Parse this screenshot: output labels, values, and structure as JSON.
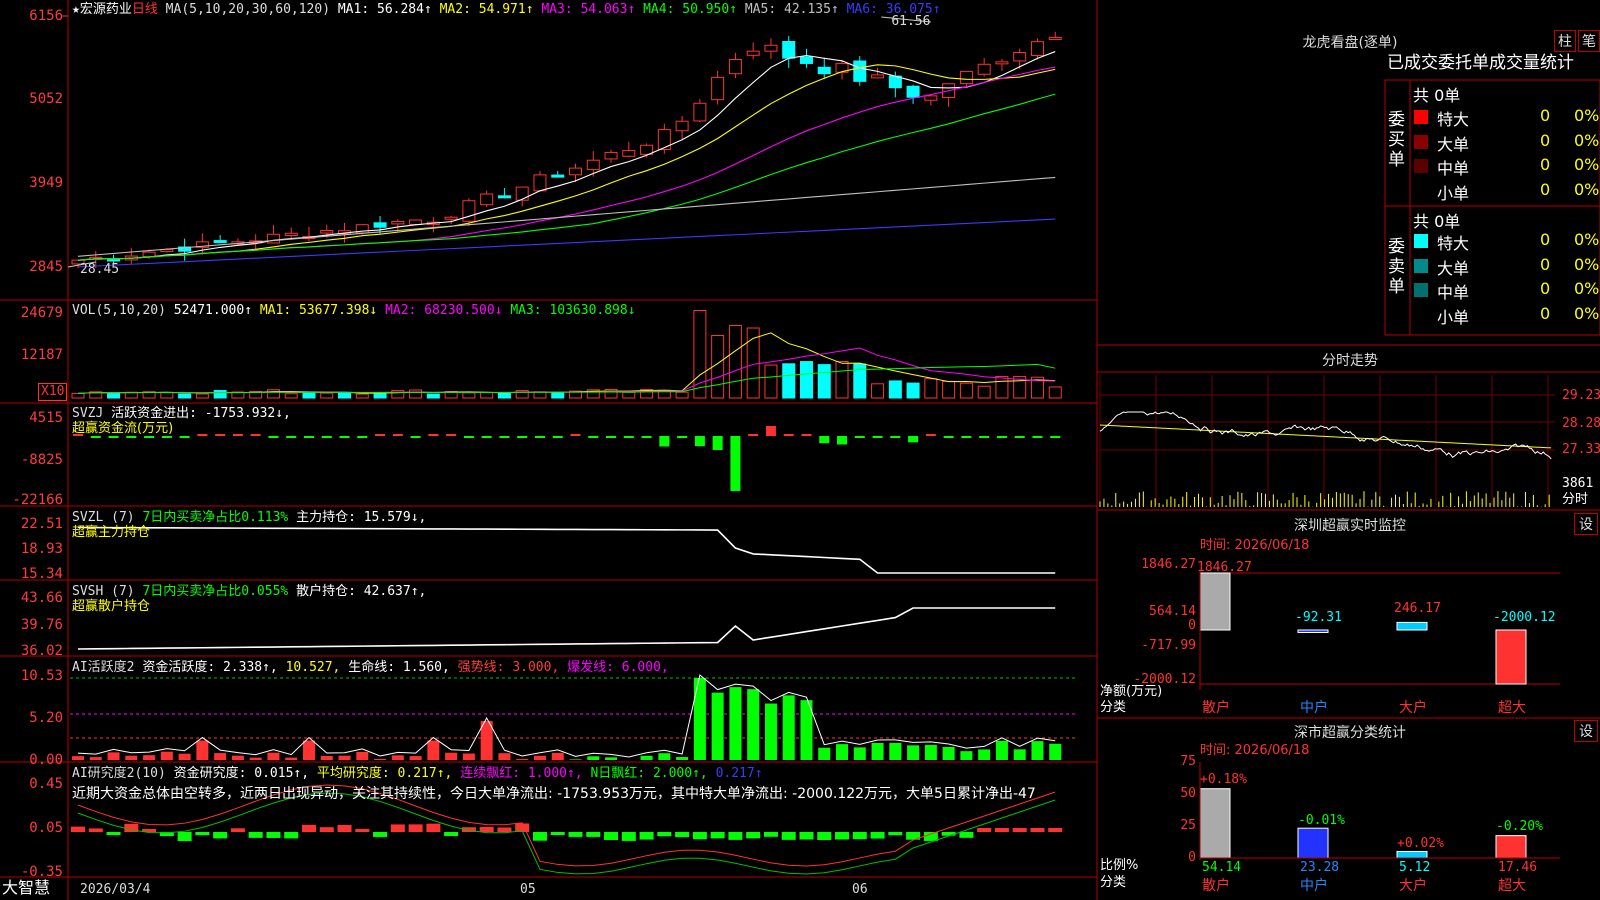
{
  "stock": {
    "name": "★宏源药业",
    "period": "日线"
  },
  "ma_line": {
    "label": "MA(5,10,20,30,60,120)",
    "items": [
      {
        "text": "MA1: 56.284↑",
        "color": "#ffffff"
      },
      {
        "text": "MA2: 54.971↑",
        "color": "#ffff00"
      },
      {
        "text": "MA3: 54.063↑",
        "color": "#ff00ff"
      },
      {
        "text": "MA4: 50.950↑",
        "color": "#00ff00"
      },
      {
        "text": "MA5: 42.135↑",
        "color": "#c0c0c0"
      },
      {
        "text": "MA6: 36.075↑",
        "color": "#3a3aff"
      }
    ]
  },
  "price_axis": [
    "6156",
    "5052",
    "3949",
    "2845"
  ],
  "price_annotations": {
    "high": "61.56",
    "low": "28.45"
  },
  "vol": {
    "label": "VOL(5,10,20)",
    "value": "52471.000↑",
    "items": [
      {
        "text": "MA1: 53677.398↓",
        "color": "#ffff00"
      },
      {
        "text": "MA2: 68230.500↓",
        "color": "#ff00ff"
      },
      {
        "text": "MA3: 103630.898↓",
        "color": "#00ff00"
      }
    ],
    "axis": [
      "24679",
      "12187"
    ],
    "unit": "X10"
  },
  "svzj": {
    "label": "SVZJ",
    "title": "活跃资金进出: -1753.932↓,",
    "subtitle": "超赢资金流(万元)",
    "axis": [
      "4515",
      "-8825",
      "-22166"
    ]
  },
  "svzl": {
    "label": "SVZL (7)",
    "title": "7日内买卖净占比0.113%",
    "value": "主力持仓: 15.579↓,",
    "subtitle": "超赢主力持仓",
    "axis": [
      "22.51",
      "18.93",
      "15.34"
    ]
  },
  "svsh": {
    "label": "SVSH (7)",
    "title": "7日内买卖净占比0.055%",
    "value": "散户持仓: 42.637↑,",
    "subtitle": "超赢散户持仓",
    "axis": [
      "43.66",
      "39.76",
      "36.02"
    ]
  },
  "ai_active": {
    "label": "AI活跃度2",
    "items": [
      {
        "text": "资金活跃度: 2.338↑,",
        "color": "#ffffff"
      },
      {
        "text": "10.527,",
        "color": "#ffff00"
      },
      {
        "text": "生命线: 1.560,",
        "color": "#ffffff"
      },
      {
        "text": "强势线: 3.000,",
        "color": "#ff3c3c"
      },
      {
        "text": "爆发线: 6.000,",
        "color": "#ff00ff"
      }
    ],
    "axis": [
      "10.53",
      "5.20",
      "0.00"
    ]
  },
  "ai_research": {
    "label": "AI研究度2(10)",
    "items": [
      {
        "text": "资金研究度: 0.015↑,",
        "color": "#ffffff"
      },
      {
        "text": "平均研究度: 0.217↑,",
        "color": "#ffff00"
      },
      {
        "text": "连续飘红: 1.000↑,",
        "color": "#ff00ff"
      },
      {
        "text": "N日飘红: 2.000↑,",
        "color": "#00ff00"
      },
      {
        "text": "0.217↑",
        "color": "#3a3aff"
      }
    ],
    "summary": "近期大资金总体由空转多，近两日出现异动，关注其持续性，今日大单净流出: -1753.953万元，其中特大单净流出: -2000.122万元，大单5日累计净出-47",
    "axis": [
      "0.45",
      "0.05",
      "-0.35"
    ]
  },
  "footer": {
    "brand": "大智慧",
    "date_start": "2026/03/4",
    "m05": "05",
    "m06": "06"
  },
  "dragon": {
    "title": "龙虎看盘(逐单)",
    "btn_bar": "柱",
    "btn_detail": "笔",
    "tabs": [
      "已成交",
      "委托单",
      "成交量统计"
    ],
    "buy_label": "委买单",
    "sell_label": "委卖单",
    "buy_total": "共 0单",
    "sell_total": "共 0单",
    "buy_rows": [
      {
        "name": "特大",
        "count": "0",
        "pct": "0%",
        "color": "#ff0000"
      },
      {
        "name": "大单",
        "count": "0",
        "pct": "0%",
        "color": "#8a0000"
      },
      {
        "name": "中单",
        "count": "0",
        "pct": "0%",
        "color": "#5a0000"
      },
      {
        "name": "小单",
        "count": "0",
        "pct": "0%",
        "color": ""
      }
    ],
    "sell_rows": [
      {
        "name": "特大",
        "count": "0",
        "pct": "0%",
        "color": "#00ffff"
      },
      {
        "name": "大单",
        "count": "0",
        "pct": "0%",
        "color": "#008b8b"
      },
      {
        "name": "中单",
        "count": "0",
        "pct": "0%",
        "color": "#007070"
      },
      {
        "name": "小单",
        "count": "0",
        "pct": "0%",
        "color": ""
      }
    ]
  },
  "intraday": {
    "title": "分时走势",
    "axis": [
      "29.23",
      "28.28",
      "27.33"
    ],
    "vol_value": "3861",
    "vol_label": "分时"
  },
  "sz_monitor": {
    "title": "深圳超赢实时监控",
    "settings": "设",
    "time": "时间: 2026/06/18",
    "axis": [
      "1846.27",
      "564.14",
      "0",
      "-717.99",
      "-2000.12"
    ],
    "ylabel": "净额(万元)",
    "xlabel": "分类"
  },
  "sz_stats": {
    "title": "深市超赢分类统计",
    "settings": "设",
    "time": "时间: 2026/06/18",
    "axis": [
      "75",
      "50",
      "25",
      "0"
    ],
    "ylabel": "比例%",
    "xlabel": "分类"
  },
  "chart_data": [
    {
      "type": "bar",
      "title": "深圳超赢实时监控",
      "ylabel": "净额(万元)",
      "xlabel": "分类",
      "categories": [
        "散户",
        "中户",
        "大户",
        "超大"
      ],
      "values": [
        1846.27,
        -92.31,
        246.17,
        -2000.12
      ],
      "ylim": [
        -2000.12,
        1846.27
      ]
    },
    {
      "type": "bar",
      "title": "深市超赢分类统计",
      "ylabel": "比例%",
      "xlabel": "分类",
      "categories": [
        "散户",
        "中户",
        "大户",
        "超大"
      ],
      "values": [
        54.14,
        23.28,
        5.12,
        17.46
      ],
      "changes": [
        "+0.18%",
        "-0.01%",
        "+0.02%",
        "-0.20%"
      ],
      "ylim": [
        0,
        75
      ]
    }
  ]
}
